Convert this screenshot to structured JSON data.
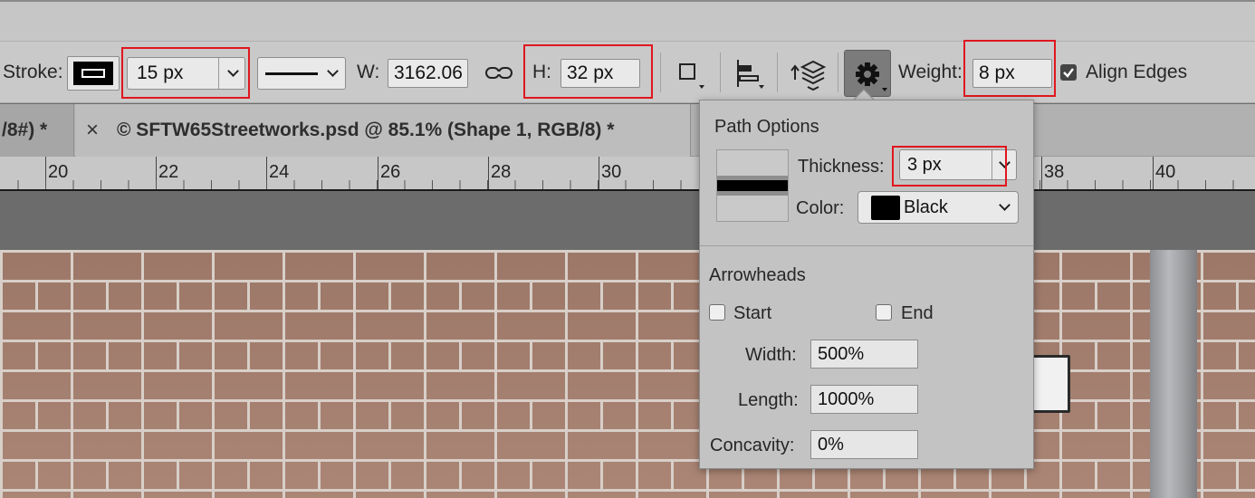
{
  "options_bar": {
    "stroke_label": "Stroke:",
    "stroke_size": "15 px",
    "w_label": "W:",
    "w_value": "3162.06",
    "h_label": "H:",
    "h_value": "32 px",
    "weight_label": "Weight:",
    "weight_value": "8 px",
    "align_edges_label": "Align Edges",
    "align_edges_checked": true
  },
  "tabs": [
    {
      "label": "/8#) *"
    },
    {
      "close": "×",
      "label": "© SFTW65Streetworks.psd @ 85.1% (Shape 1, RGB/8) *"
    }
  ],
  "ruler": {
    "ticks": [
      "20",
      "22",
      "24",
      "26",
      "28",
      "30",
      "38",
      "40"
    ]
  },
  "path_options": {
    "title": "Path Options",
    "thickness_label": "Thickness:",
    "thickness_value": "3 px",
    "color_label": "Color:",
    "color_value": "Black",
    "color_swatch": "#000000",
    "arrowheads_title": "Arrowheads",
    "start_label": "Start",
    "end_label": "End",
    "width_label": "Width:",
    "width_value": "500%",
    "length_label": "Length:",
    "length_value": "1000%",
    "concavity_label": "Concavity:",
    "concavity_value": "0%"
  },
  "highlight_color": "#e0161e"
}
